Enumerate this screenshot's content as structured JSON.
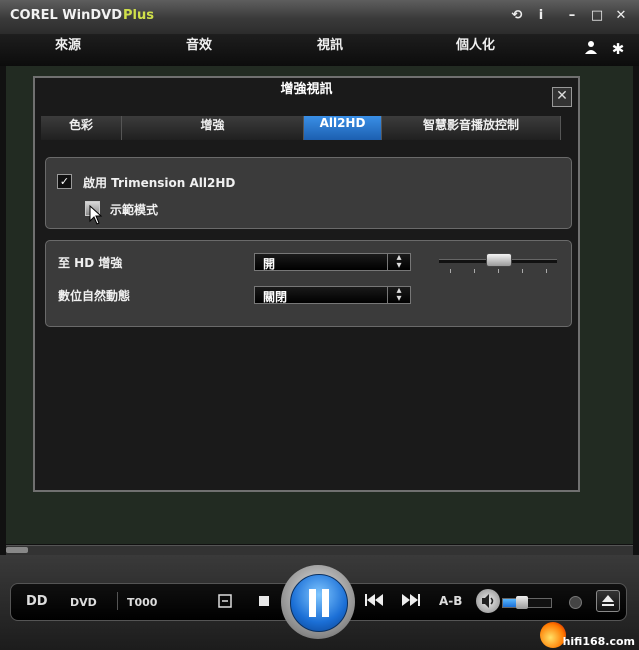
{
  "app": {
    "title": "COREL WinDVD",
    "edition": "Plus"
  },
  "window_buttons": {
    "pin": "⟲",
    "info": "i",
    "minimize": "–",
    "maximize": "□",
    "close": "✕"
  },
  "nav": {
    "items": [
      "來源",
      "音效",
      "視訊",
      "個人化"
    ],
    "icons": {
      "user": "user-icon",
      "settings": "gear-icon"
    }
  },
  "dialog": {
    "title": "增強視訊",
    "close": "✕",
    "tabs": [
      "色彩",
      "增強",
      "All2HD",
      "智慧影音播放控制"
    ],
    "active_tab": "All2HD",
    "enable": {
      "label": "啟用 Trimension All2HD",
      "checked": true
    },
    "demo": {
      "label": "示範模式",
      "checked": false
    },
    "rows": [
      {
        "label": "至 HD 增強",
        "value": "開"
      },
      {
        "label": "數位自然動態",
        "value": "關閉"
      }
    ]
  },
  "controls": {
    "dolby": "DD",
    "source": "DVD",
    "time": "T000",
    "ab": "A-B",
    "icons": [
      "menu-icon",
      "stop-icon",
      "play-pause-icon",
      "prev-icon",
      "next-icon",
      "volume-icon",
      "eject-icon"
    ],
    "volume_level": 0.4
  },
  "watermark": "hifi168.com",
  "colors": {
    "accent": "#1c6fd6",
    "brand": "#cfe04a"
  }
}
